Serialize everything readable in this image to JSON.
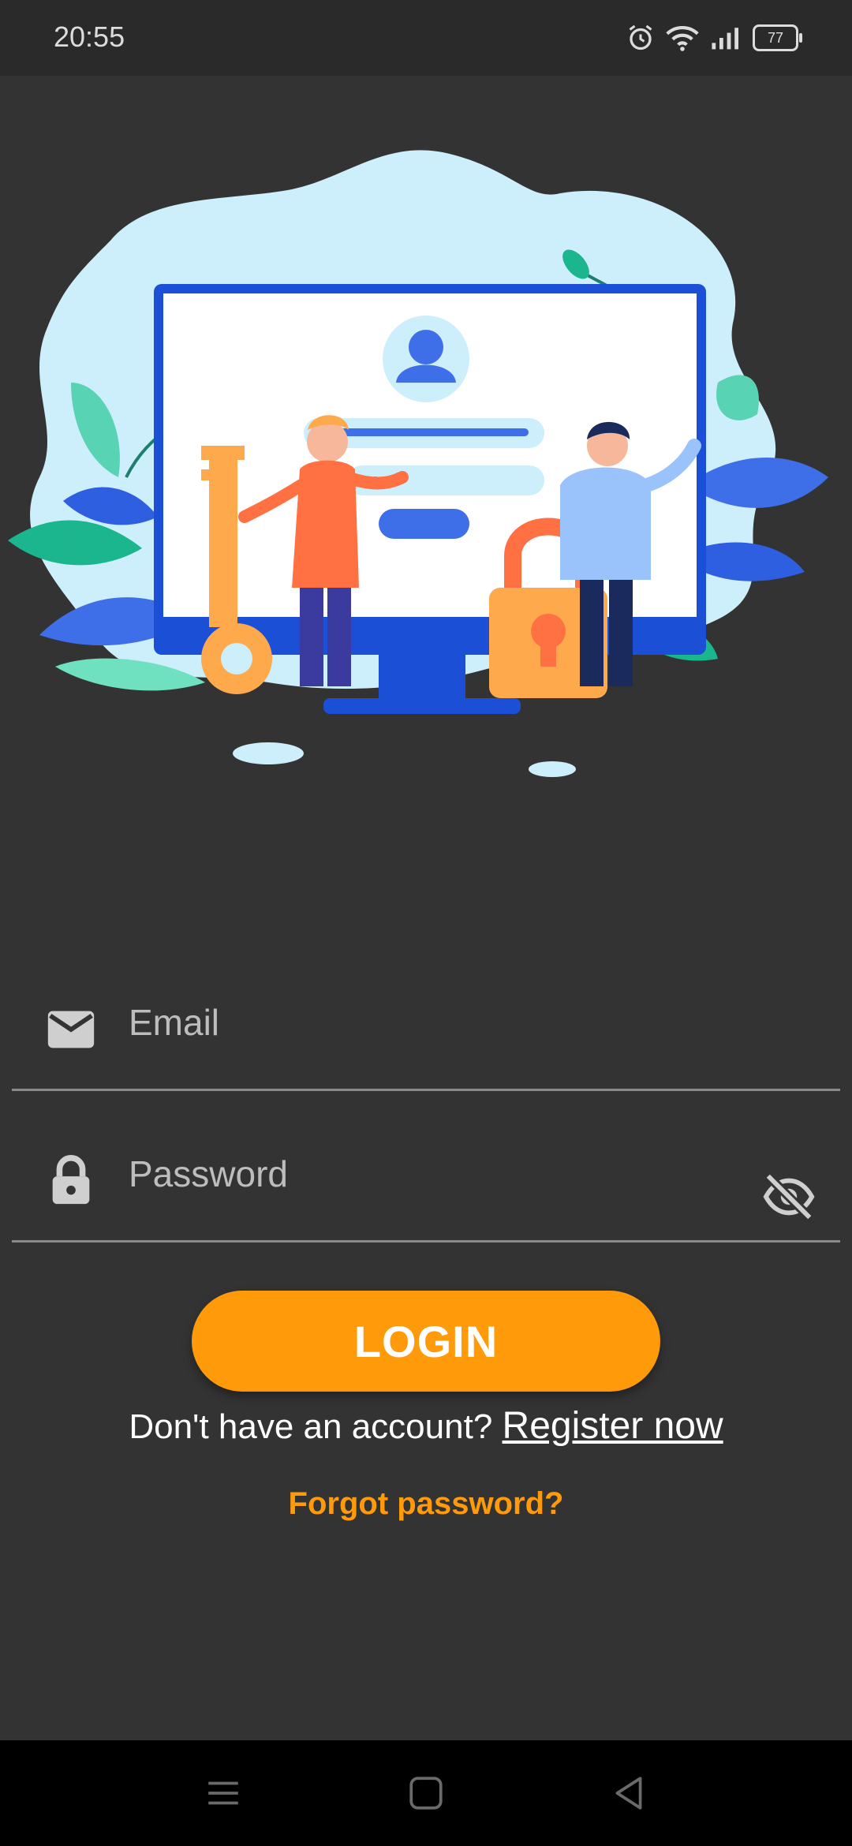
{
  "status_bar": {
    "time": "20:55",
    "battery": "77",
    "icons": [
      "alarm-icon",
      "wifi-icon",
      "signal-icon",
      "battery-icon"
    ]
  },
  "form": {
    "email_placeholder": "Email",
    "password_placeholder": "Password",
    "login_label": "LOGIN",
    "no_account_text": "Don't have an account?",
    "register_link": "Register now",
    "forgot_link": "Forgot password?"
  },
  "colors": {
    "background": "#333333",
    "accent": "#ff9a0a",
    "blob": "#cdeefb",
    "monitor": "#1a4fd6"
  },
  "navigation": {
    "icons": [
      "menu-icon",
      "home-square-icon",
      "back-triangle-icon"
    ]
  }
}
